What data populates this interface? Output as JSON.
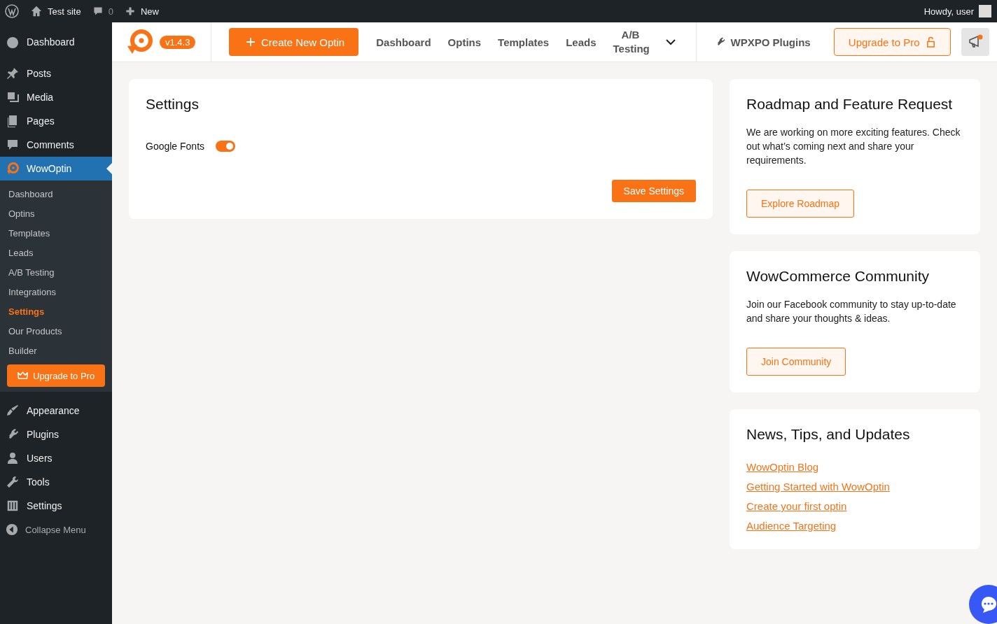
{
  "admin_bar": {
    "site": "Test site",
    "comments": "0",
    "new": "New",
    "howdy": "Howdy, user"
  },
  "sidebar": {
    "items": [
      {
        "label": "Dashboard",
        "selected": false
      },
      {
        "label": "Posts",
        "selected": false
      },
      {
        "label": "Media",
        "selected": false
      },
      {
        "label": "Pages",
        "selected": false
      },
      {
        "label": "Comments",
        "selected": false
      },
      {
        "label": "WowOptin",
        "selected": true
      }
    ],
    "submenu": [
      {
        "label": "Dashboard",
        "selected": false
      },
      {
        "label": "Optins",
        "selected": false
      },
      {
        "label": "Templates",
        "selected": false
      },
      {
        "label": "Leads",
        "selected": false
      },
      {
        "label": "A/B Testing",
        "selected": false
      },
      {
        "label": "Integrations",
        "selected": false
      },
      {
        "label": "Settings",
        "selected": true
      },
      {
        "label": "Our Products",
        "selected": false
      },
      {
        "label": "Builder",
        "selected": false
      }
    ],
    "upgrade": "Upgrade to Pro",
    "items_after": [
      {
        "label": "Appearance",
        "selected": false
      },
      {
        "label": "Plugins",
        "selected": false
      },
      {
        "label": "Users",
        "selected": false
      },
      {
        "label": "Tools",
        "selected": false
      },
      {
        "label": "Settings",
        "selected": false
      }
    ],
    "collapse": "Collapse Menu"
  },
  "header": {
    "version": "v1.4.3",
    "create": "Create New Optin",
    "nav": [
      {
        "label": "Dashboard",
        "selected": false
      },
      {
        "label": "Optins",
        "selected": false
      },
      {
        "label": "Templates",
        "selected": false
      },
      {
        "label": "Leads",
        "selected": false
      },
      {
        "label": "A/B Testing",
        "selected": false
      }
    ],
    "plugins": "WPXPO Plugins",
    "upgrade": "Upgrade to Pro"
  },
  "settings": {
    "title": "Settings",
    "google_fonts": {
      "label": "Google Fonts",
      "on": true
    },
    "save": "Save Settings"
  },
  "cards": [
    {
      "title": "Roadmap and Feature Request",
      "text": "We are working on more exciting features. Check out what’s coming next and share your requirements.",
      "button": "Explore Roadmap"
    },
    {
      "title": "WowCommerce Community",
      "text": "Join our Facebook community to stay up-to-date and share your thoughts & ideas.",
      "button": "Join Community"
    }
  ],
  "news": {
    "title": "News, Tips, and Updates",
    "links": [
      "WowOptin Blog",
      "Getting Started with WowOptin",
      "Create your first optin",
      "Audience Targeting"
    ]
  }
}
